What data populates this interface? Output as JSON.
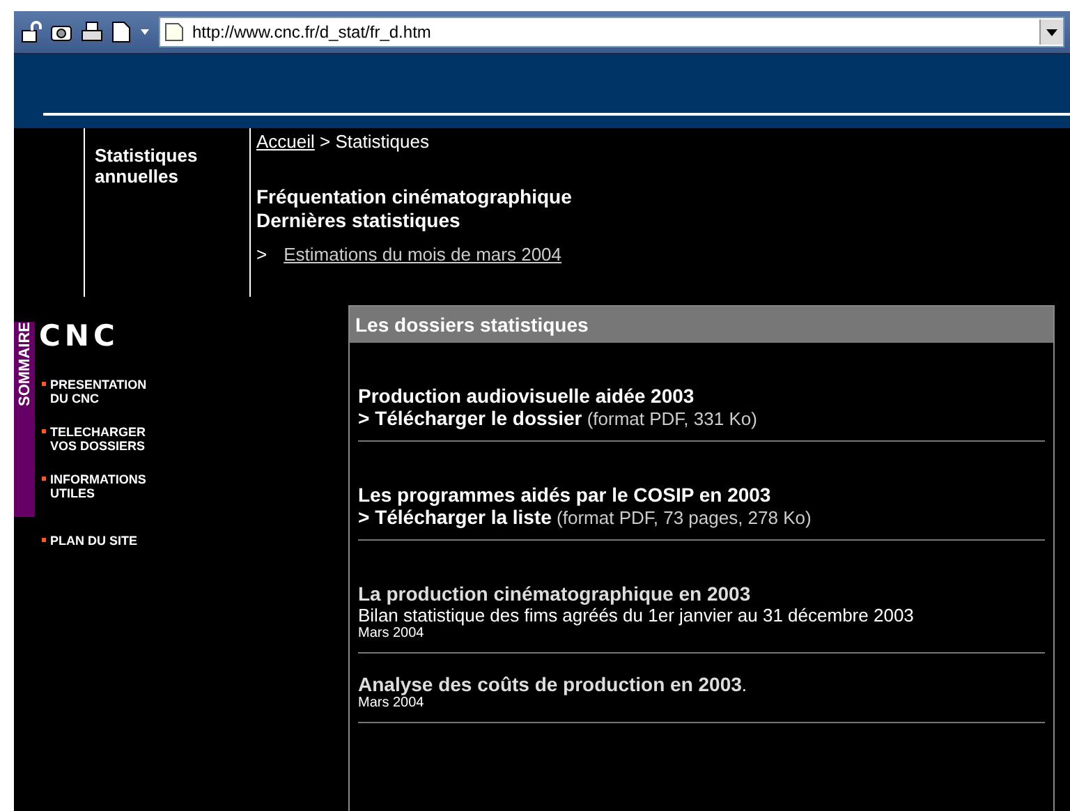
{
  "browser": {
    "address": "http://www.cnc.fr/d_stat/fr_d.htm"
  },
  "side_title": "Statistiques annuelles",
  "breadcrumb": {
    "home": "Accueil",
    "separator": ">",
    "current": "Statistiques"
  },
  "heading": [
    "Fréquentation cinématographique",
    "Dernières statistiques"
  ],
  "latest_link": {
    "marker": ">",
    "label": "Estimations du mois de mars 2004"
  },
  "sidebar": {
    "label": "SOMMAIRE",
    "logo": "CNC",
    "items": [
      {
        "lines": [
          "PRESENTATION",
          "DU CNC"
        ]
      },
      {
        "lines": [
          "TELECHARGER",
          "VOS DOSSIERS"
        ]
      },
      {
        "lines": [
          "INFORMATIONS",
          "UTILES"
        ]
      },
      {
        "lines": [
          "PLAN DU SITE"
        ]
      }
    ]
  },
  "panel": {
    "title": "Les dossiers statistiques",
    "items": [
      {
        "kind": "download",
        "title": "Production audiovisuelle aidée 2003",
        "link": "> Télécharger le dossier",
        "note": "(format PDF, 331 Ko)"
      },
      {
        "kind": "download",
        "title": "Les programmes aidés par le COSIP en 2003",
        "link": "> Télécharger la liste",
        "note": "(format PDF, 73 pages, 278 Ko)"
      },
      {
        "kind": "report",
        "link": "La production cinématographique en 2003",
        "description": "Bilan statistique des fims agréés du 1er janvier au 31 décembre 2003",
        "date": "Mars 2004"
      },
      {
        "kind": "report",
        "link": "Analyse des coûts de production en 2003",
        "suffix": ".",
        "date": "Mars 2004"
      }
    ]
  }
}
